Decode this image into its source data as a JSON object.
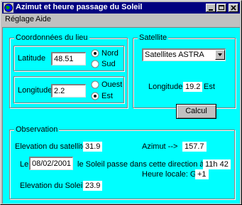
{
  "window": {
    "title": "Azimut et heure passage du Soleil",
    "icon": "globe-icon"
  },
  "menu": {
    "items": [
      "Réglage",
      "Aide"
    ]
  },
  "lieu": {
    "group_label": "Coordonnées du lieu",
    "latitude_label": "Latitude",
    "latitude_value": "48.51",
    "lat_options": [
      "Nord",
      "Sud"
    ],
    "lat_selected": "Nord",
    "longitude_label": "Longitude",
    "longitude_value": "2.2",
    "lon_options": [
      "Ouest",
      "Est"
    ],
    "lon_selected": "Est"
  },
  "satellite": {
    "group_label": "Satellite",
    "selected": "Satellites ASTRA",
    "longitude_label": "Longitude",
    "longitude_value": "19.2",
    "longitude_dir": "Est"
  },
  "calcul_label": "Calcul",
  "observation": {
    "group_label": "Observation",
    "elev_sat_label": "Elevation du satellite",
    "elev_sat_value": "31.9",
    "azimut_label": "Azimut -->",
    "azimut_value": "157.7",
    "le_label": "Le",
    "date_value": "08/02/2001",
    "passe_label": "le Soleil passe dans cette direction à:",
    "time_value": "11h 42",
    "heure_label": "Heure locale: GMT",
    "gmt_value": "+1",
    "elev_soleil_label": "Elevation du Soleil",
    "elev_soleil_value": "23.9"
  }
}
